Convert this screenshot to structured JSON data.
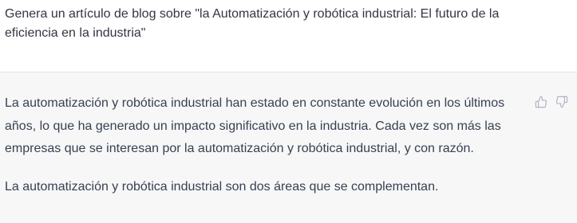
{
  "conversation": {
    "user_message": {
      "text": "Genera un artículo de blog sobre \"la Automatización y robótica industrial: El futuro de la eficiencia en la industria\""
    },
    "assistant_message": {
      "paragraphs": [
        "La automatización y robótica industrial han estado en constante evolución en los últimos años, lo que ha generado un impacto significativo en la industria. Cada vez son más las empresas que se interesan por la automatización y robótica industrial, y con razón.",
        "La automatización y robótica industrial son dos áreas que se complementan."
      ],
      "feedback": {
        "thumbs_up_icon": "thumbs-up-icon",
        "thumbs_down_icon": "thumbs-down-icon"
      }
    }
  },
  "colors": {
    "user_bg": "#ffffff",
    "assistant_bg": "#f7f7f8",
    "text": "#374151",
    "icon": "#acacbe",
    "divider": "#e5e5e6"
  }
}
